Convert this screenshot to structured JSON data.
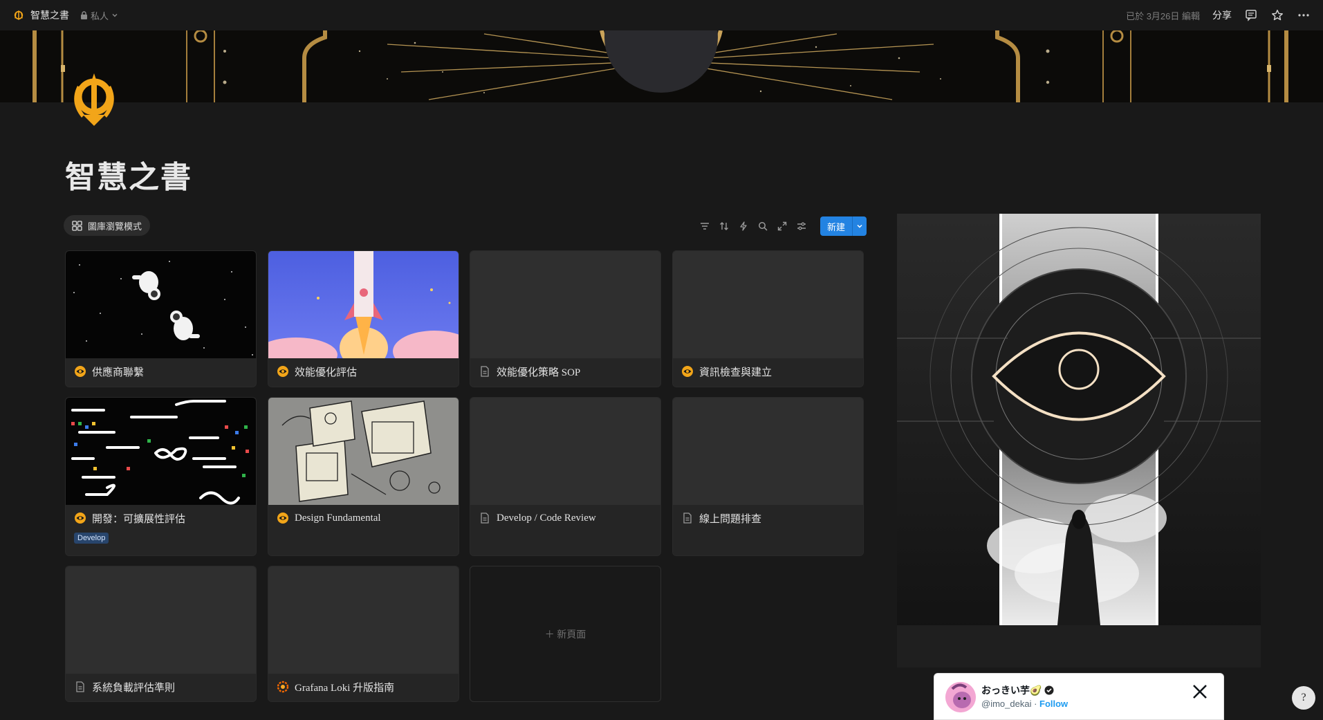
{
  "topbar": {
    "title": "智慧之書",
    "privacy": "私人",
    "edited": "已於 3月26日 編輯",
    "share": "分享",
    "icons": [
      "comment-icon",
      "star-icon",
      "more-icon"
    ]
  },
  "page": {
    "title": "智慧之書"
  },
  "view": {
    "tab_label": "圖庫瀏覽模式",
    "toolbar_icons": [
      "filter-icon",
      "sort-icon",
      "automation-icon",
      "search-icon",
      "expand-icon",
      "settings-icon"
    ],
    "new_label": "新建"
  },
  "cards": [
    {
      "title": "供應商聯繫",
      "icon": "eye-icon",
      "thumb": "astronauts"
    },
    {
      "title": "效能優化評估",
      "icon": "eye-icon",
      "thumb": "rocket"
    },
    {
      "title": "效能優化策略 SOP",
      "icon": "page-icon",
      "thumb": "empty"
    },
    {
      "title": "資訊檢查與建立",
      "icon": "eye-icon",
      "thumb": "empty"
    },
    {
      "title": "開發：可擴展性評估",
      "icon": "eye-icon",
      "thumb": "code",
      "tag": "Develop"
    },
    {
      "title": "Design Fundamental",
      "icon": "eye-icon",
      "thumb": "machines"
    },
    {
      "title": "Develop / Code Review",
      "icon": "page-icon",
      "thumb": "empty"
    },
    {
      "title": "線上問題排查",
      "icon": "page-icon",
      "thumb": "empty"
    },
    {
      "title": "系統負載評估準則",
      "icon": "page-icon",
      "thumb": "empty"
    },
    {
      "title": "Grafana Loki 升版指南",
      "icon": "grafana-icon",
      "thumb": "empty"
    }
  ],
  "new_page_label": "＋ 新頁面",
  "tweet": {
    "name": "おっきい芋🥑",
    "handle": "@imo_dekai",
    "separator": " · ",
    "follow": "Follow"
  },
  "help_glyph": "?"
}
